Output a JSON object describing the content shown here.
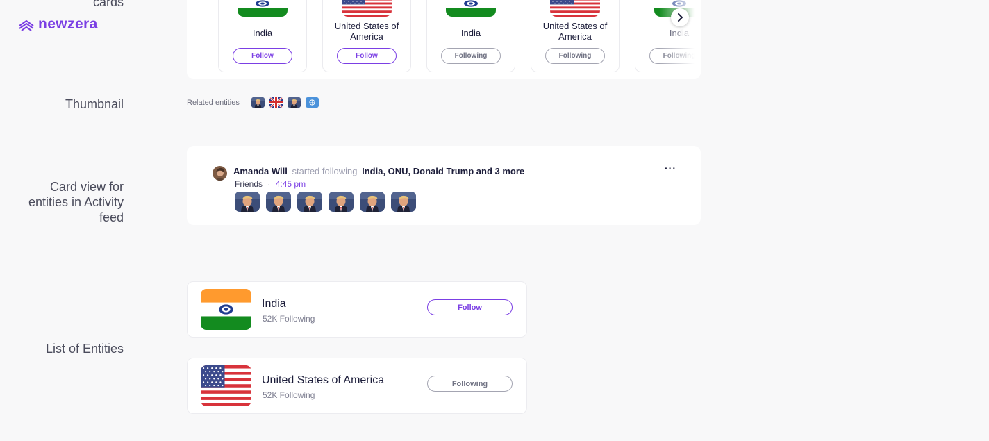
{
  "brand": {
    "name": "newzera",
    "color": "#7b3fe4"
  },
  "sections": {
    "cards": "cards",
    "thumbnail": "Thumbnail",
    "activity": [
      "Card view for",
      "entities in Activity",
      "feed"
    ],
    "list": "List of Entities"
  },
  "carousel": [
    {
      "name": "India",
      "flag": "india",
      "action": "Follow",
      "state": "follow"
    },
    {
      "name": "United States of America",
      "flag": "usa",
      "action": "Follow",
      "state": "follow"
    },
    {
      "name": "India",
      "flag": "india",
      "action": "Following",
      "state": "following"
    },
    {
      "name": "United States of America",
      "flag": "usa",
      "action": "Following",
      "state": "following"
    },
    {
      "name": "India",
      "flag": "india",
      "action": "Following",
      "state": "following"
    }
  ],
  "related": {
    "label": "Related entities",
    "icons": [
      "person-thumbnail",
      "uk-flag-icon",
      "person-thumbnail",
      "un-logo-icon"
    ]
  },
  "activity": {
    "user": "Amanda Will",
    "verb": "started following",
    "entities": "India, ONU, Donald Trump and 3 more",
    "audience": "Friends",
    "separator": "·",
    "time": "4:45 pm",
    "more": "···",
    "thumbnail_count": 6
  },
  "list": [
    {
      "name": "India",
      "count": "52K Following",
      "action": "Follow",
      "state": "follow",
      "flag": "india"
    },
    {
      "name": "United States of America",
      "count": "52K Following",
      "action": "Following",
      "state": "following",
      "flag": "usa"
    }
  ],
  "colors": {
    "accent": "#7b3fe4",
    "muted_border": "#a4a5b2",
    "saffron": "#ff9933",
    "green": "#138808",
    "usa_red": "#b22234",
    "usa_blue": "#3c3b6e"
  }
}
